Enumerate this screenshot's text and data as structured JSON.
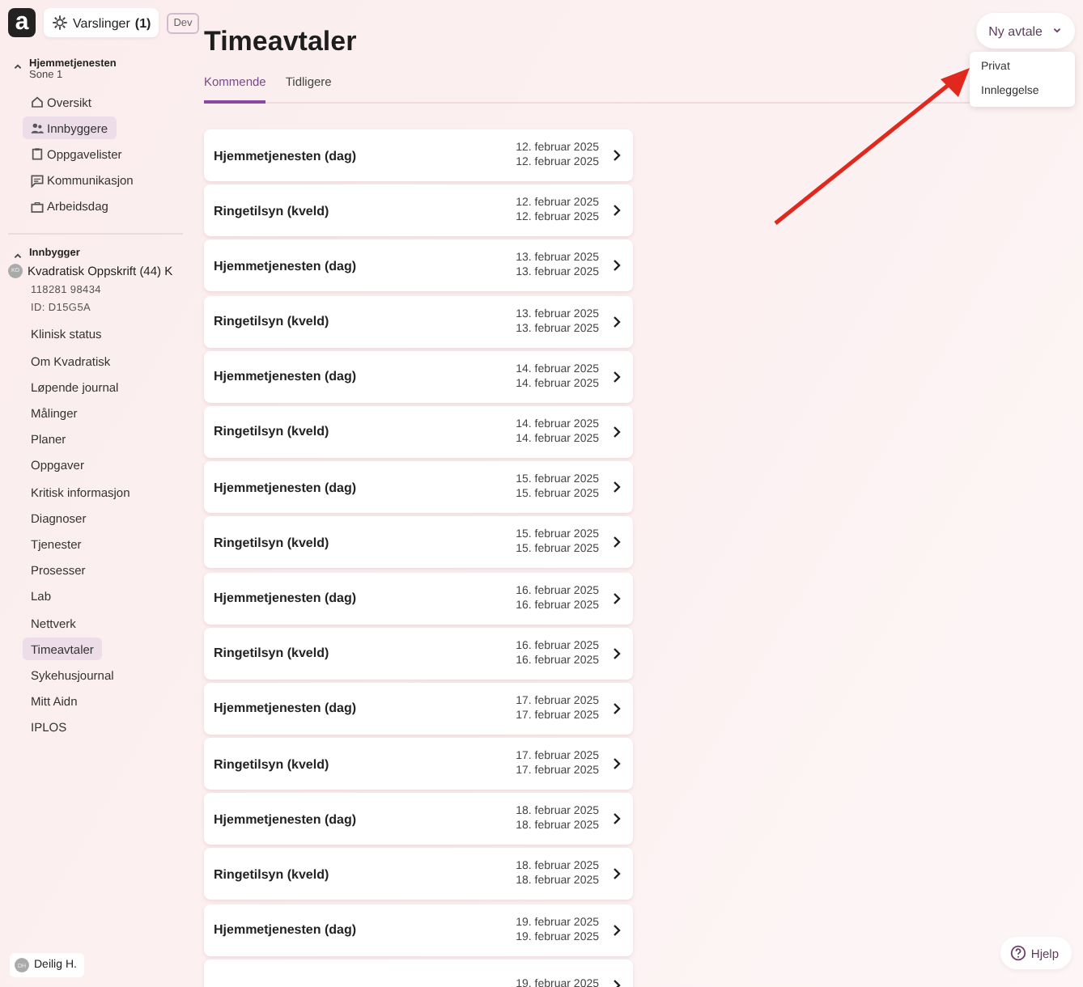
{
  "header": {
    "logo": "a",
    "notifications": {
      "label": "Varslinger",
      "count": "(1)"
    },
    "env_badge": "Dev"
  },
  "sidebar": {
    "sections": [
      {
        "title": "Hjemmetjenesten",
        "subtitle": "Sone 1",
        "expanded": true,
        "items": [
          {
            "label": "Oversikt",
            "selected": false
          },
          {
            "label": "Innbyggere",
            "selected": true
          },
          {
            "label": "Oppgavelister",
            "selected": false
          },
          {
            "label": "Kommunikasjon",
            "selected": false
          },
          {
            "label": "Arbeidsdag",
            "selected": false
          }
        ]
      },
      {
        "title": "Innbygger",
        "expanded": true,
        "patient": {
          "initials": "KO",
          "name": "Kvadratisk Oppskrift (44) K",
          "number": "118281 98434",
          "id": "ID: D15G5A"
        },
        "items": [
          {
            "label": "Klinisk status",
            "selected": false
          },
          {
            "label": "Om Kvadratisk",
            "selected": false
          },
          {
            "label": "Løpende journal",
            "selected": false
          },
          {
            "label": "Målinger",
            "selected": false
          },
          {
            "label": "Planer",
            "selected": false
          },
          {
            "label": "Oppgaver",
            "selected": false
          },
          {
            "label": "Kritisk informasjon",
            "selected": false
          },
          {
            "label": "Diagnoser",
            "selected": false
          },
          {
            "label": "Tjenester",
            "selected": false
          },
          {
            "label": "Prosesser",
            "selected": false
          },
          {
            "label": "Lab",
            "selected": false
          },
          {
            "label": "Nettverk",
            "selected": false
          },
          {
            "label": "Timeavtaler",
            "selected": true
          },
          {
            "label": "Sykehusjournal",
            "selected": false
          },
          {
            "label": "Mitt Aidn",
            "selected": false
          },
          {
            "label": "IPLOS",
            "selected": false
          }
        ]
      }
    ],
    "user": {
      "initials": "DH",
      "name": "Deilig H."
    }
  },
  "page": {
    "title": "Timeavtaler",
    "tabs": [
      {
        "label": "Kommende",
        "selected": true
      },
      {
        "label": "Tidligere",
        "selected": false
      }
    ],
    "new_button": {
      "label": "Ny avtale",
      "expanded": true,
      "menu": [
        "Privat",
        "Innleggelse"
      ]
    },
    "appointments": [
      {
        "title": "Hjemmetjenesten (dag)",
        "start": "12. februar 2025",
        "end": "12. februar 2025"
      },
      {
        "title": "Ringetilsyn (kveld)",
        "start": "12. februar 2025",
        "end": "12. februar 2025"
      },
      {
        "title": "Hjemmetjenesten (dag)",
        "start": "13. februar 2025",
        "end": "13. februar 2025"
      },
      {
        "title": "Ringetilsyn (kveld)",
        "start": "13. februar 2025",
        "end": "13. februar 2025"
      },
      {
        "title": "Hjemmetjenesten (dag)",
        "start": "14. februar 2025",
        "end": "14. februar 2025"
      },
      {
        "title": "Ringetilsyn (kveld)",
        "start": "14. februar 2025",
        "end": "14. februar 2025"
      },
      {
        "title": "Hjemmetjenesten (dag)",
        "start": "15. februar 2025",
        "end": "15. februar 2025"
      },
      {
        "title": "Ringetilsyn (kveld)",
        "start": "15. februar 2025",
        "end": "15. februar 2025"
      },
      {
        "title": "Hjemmetjenesten (dag)",
        "start": "16. februar 2025",
        "end": "16. februar 2025"
      },
      {
        "title": "Ringetilsyn (kveld)",
        "start": "16. februar 2025",
        "end": "16. februar 2025"
      },
      {
        "title": "Hjemmetjenesten (dag)",
        "start": "17. februar 2025",
        "end": "17. februar 2025"
      },
      {
        "title": "Ringetilsyn (kveld)",
        "start": "17. februar 2025",
        "end": "17. februar 2025"
      },
      {
        "title": "Hjemmetjenesten (dag)",
        "start": "18. februar 2025",
        "end": "18. februar 2025"
      },
      {
        "title": "Ringetilsyn (kveld)",
        "start": "18. februar 2025",
        "end": "18. februar 2025"
      },
      {
        "title": "Hjemmetjenesten (dag)",
        "start": "19. februar 2025",
        "end": "19. februar 2025"
      },
      {
        "start": "19. februar 2025"
      }
    ]
  },
  "help_button": "Hjelp"
}
